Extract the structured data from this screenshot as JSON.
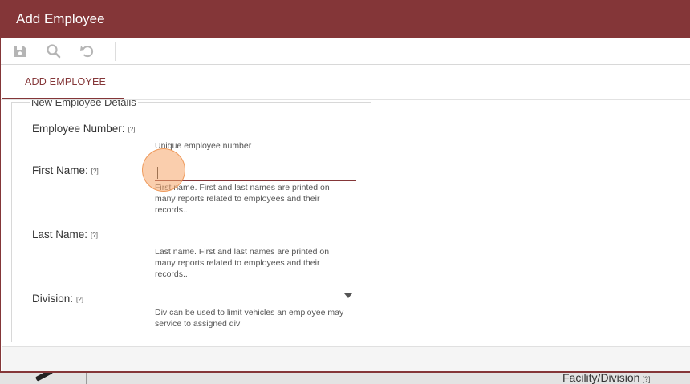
{
  "window": {
    "title": "Add Employee"
  },
  "toolbar": {
    "save_icon": "save-icon",
    "search_icon": "search-icon",
    "undo_icon": "undo-icon"
  },
  "tabs": [
    {
      "label": "ADD EMPLOYEE",
      "active": true
    }
  ],
  "section": {
    "legend": "New Employee Details"
  },
  "fields": {
    "employee_number": {
      "label": "Employee Number:",
      "help": "[?]",
      "value": "",
      "hint": "Unique employee number"
    },
    "first_name": {
      "label": "First Name:",
      "help": "[?]",
      "value": "",
      "hint_lines": [
        "First name. First and last names are printed on",
        "many reports related to employees and their",
        "records.."
      ]
    },
    "last_name": {
      "label": "Last Name:",
      "help": "[?]",
      "value": "",
      "hint_lines": [
        "Last name. First and last names are printed on",
        "many reports related to employees and their",
        "records.."
      ]
    },
    "division": {
      "label": "Division:",
      "help": "[?]",
      "value": "",
      "hint_lines": [
        "Div can be used to limit vehicles an employee may",
        "service to assigned div"
      ]
    }
  },
  "background": {
    "facility_label": "Facility/Division",
    "facility_help": "[?]"
  },
  "colors": {
    "accent": "#843638",
    "click_indicator": "#f5a669"
  }
}
